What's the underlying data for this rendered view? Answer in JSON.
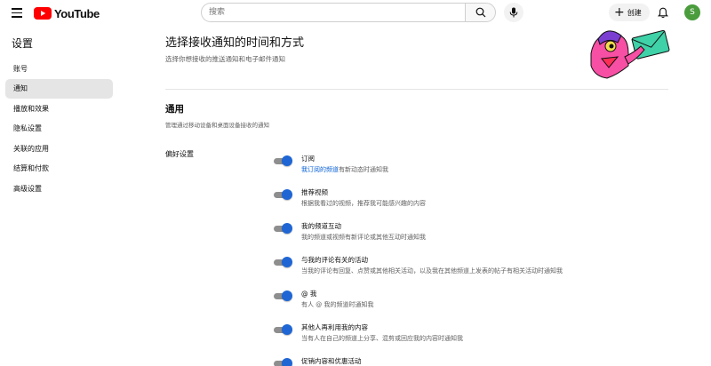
{
  "header": {
    "logo_text": "YouTube",
    "search_placeholder": "搜索",
    "create_label": "创建",
    "avatar_letter": "S",
    "brand_color": "#ff0000",
    "avatar_color": "#4a9c3c"
  },
  "sidebar": {
    "title": "设置",
    "items": [
      {
        "label": "账号",
        "active": false
      },
      {
        "label": "通知",
        "active": true
      },
      {
        "label": "播放和效果",
        "active": false
      },
      {
        "label": "隐私设置",
        "active": false
      },
      {
        "label": "关联的应用",
        "active": false
      },
      {
        "label": "结算和付款",
        "active": false
      },
      {
        "label": "高级设置",
        "active": false
      }
    ]
  },
  "main": {
    "title": "选择接收通知的时间和方式",
    "subtitle": "选择你想接收的推送通知和电子邮件通知",
    "section": {
      "title": "通用",
      "description": "管理通过移动设备和桌面设备接收的通知",
      "preferences_label": "偏好设置"
    },
    "settings": [
      {
        "title": "订阅",
        "desc_link": "我订阅的频道",
        "desc": "有新动态时通知我",
        "enabled": true
      },
      {
        "title": "推荐视频",
        "desc": "根据我看过的视频，推荐我可能感兴趣的内容",
        "enabled": true
      },
      {
        "title": "我的频道互动",
        "desc": "我的频道或视频有新评论或其他互动时通知我",
        "enabled": true
      },
      {
        "title": "与我的评论有关的活动",
        "desc": "当我的评论有回复、点赞或其他相关活动，以及我在其他频道上发表的帖子有相关活动时通知我",
        "enabled": true
      },
      {
        "title": "@ 我",
        "desc": "有人 @ 我的频道时通知我",
        "enabled": true
      },
      {
        "title": "其他人再利用我的内容",
        "desc": "当有人在自己的频道上分享、混剪或回应我的内容时通知我",
        "enabled": true
      },
      {
        "title": "促销内容和优惠活动",
        "desc": "",
        "enabled": true
      }
    ],
    "toggle_color": "#1f66d4"
  }
}
